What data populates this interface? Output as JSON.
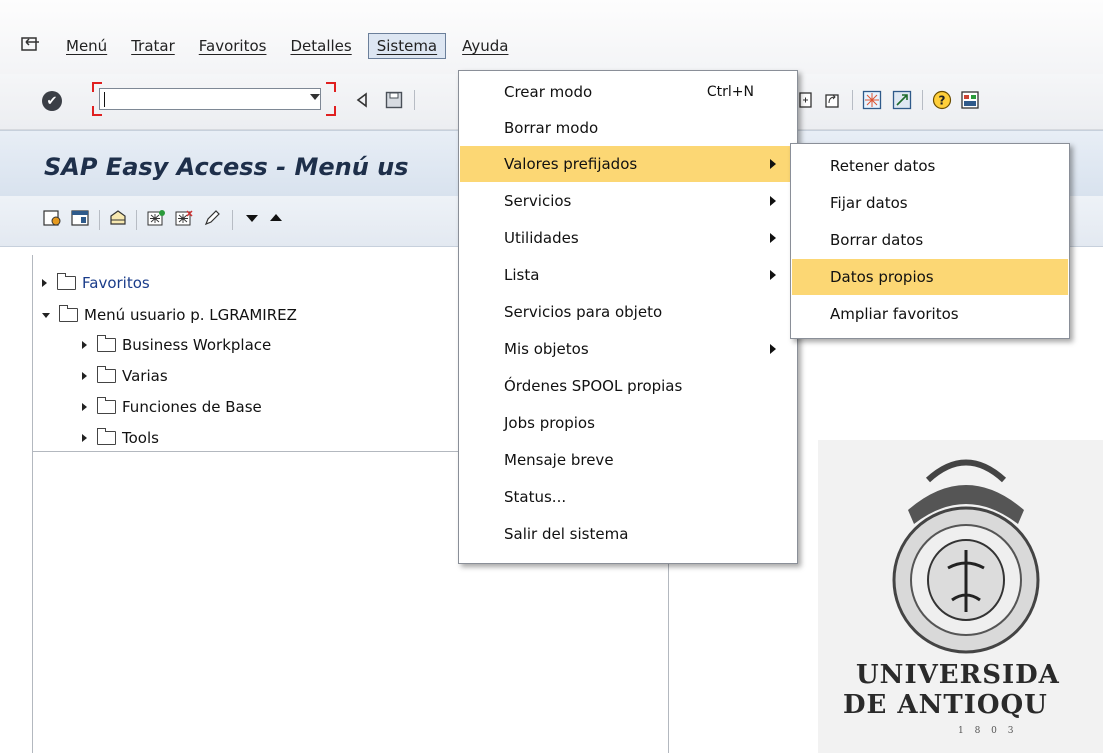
{
  "menubar": {
    "icon": "menu-expand-icon",
    "items": [
      {
        "label": "Menú"
      },
      {
        "label": "Tratar"
      },
      {
        "label": "Favoritos"
      },
      {
        "label": "Detalles"
      },
      {
        "label": "Sistema"
      },
      {
        "label": "Ayuda"
      }
    ]
  },
  "toolbar": {
    "command_value": "",
    "icons": [
      "ok-icon",
      "back-icon",
      "save-icon",
      "new-session-icon",
      "shortcut-icon",
      "layout-icon",
      "help-icon",
      "customize-icon"
    ]
  },
  "page": {
    "title": "SAP Easy Access  -  Menú us"
  },
  "app_toolbar": {
    "icons": [
      "user-menu-icon",
      "sap-menu-icon",
      "other-menu-icon",
      "add-favorite-icon",
      "delete-favorite-icon",
      "change-favorite-icon",
      "move-down-icon",
      "move-up-icon"
    ]
  },
  "tree": {
    "nodes": [
      {
        "label": "Favoritos",
        "expanded": false,
        "level": 0
      },
      {
        "label": "Menú usuario p. LGRAMIREZ",
        "expanded": true,
        "level": 0
      },
      {
        "label": "Business Workplace",
        "expanded": false,
        "level": 1
      },
      {
        "label": "Varias",
        "expanded": false,
        "level": 1
      },
      {
        "label": "Funciones de Base",
        "expanded": false,
        "level": 1
      },
      {
        "label": "Tools",
        "expanded": false,
        "level": 1
      }
    ]
  },
  "sistema_menu": {
    "items": [
      {
        "label": "Crear modo",
        "accelerator": "Ctrl+N"
      },
      {
        "label": "Borrar modo"
      },
      {
        "label": "Valores prefijados",
        "submenu": true,
        "highlighted": true
      },
      {
        "label": "Servicios",
        "submenu": true
      },
      {
        "label": "Utilidades",
        "submenu": true
      },
      {
        "label": "Lista",
        "submenu": true
      },
      {
        "label": "Servicios para objeto"
      },
      {
        "label": "Mis objetos",
        "submenu": true
      },
      {
        "label": "Órdenes SPOOL propias"
      },
      {
        "label": "Jobs propios"
      },
      {
        "label": "Mensaje breve"
      },
      {
        "label": "Status..."
      },
      {
        "label": "Salir del sistema"
      }
    ]
  },
  "valores_menu": {
    "items": [
      {
        "label": "Retener datos"
      },
      {
        "label": "Fijar datos"
      },
      {
        "label": "Borrar datos"
      },
      {
        "label": "Datos propios",
        "highlighted": true
      },
      {
        "label": "Ampliar favoritos"
      }
    ]
  },
  "logo": {
    "line1": "UNIVERSIDA",
    "line2": "DE ANTIOQU",
    "line3": "1 8 0 3"
  },
  "colors": {
    "highlight": "#fcd774",
    "title_bg": "#d8e2ee",
    "active_menu_bg": "#dde6f2"
  }
}
